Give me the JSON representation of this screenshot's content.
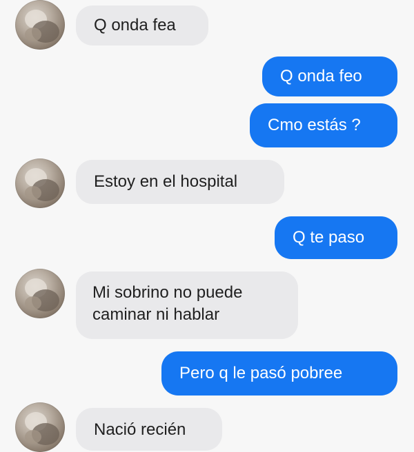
{
  "chat": {
    "messages": [
      {
        "side": "incoming",
        "text": "Q onda fea"
      },
      {
        "side": "outgoing",
        "text": "Q onda feo"
      },
      {
        "side": "outgoing",
        "text": "Cmo estás ?"
      },
      {
        "side": "incoming",
        "text": "Estoy en el hospital"
      },
      {
        "side": "outgoing",
        "text": "Q te paso"
      },
      {
        "side": "incoming",
        "lines": [
          "Mi sobrino no puede",
          "caminar ni hablar"
        ]
      },
      {
        "side": "outgoing",
        "text": "Pero q le pasó pobree"
      },
      {
        "side": "incoming",
        "text": "Nació recién"
      }
    ]
  },
  "colors": {
    "incoming_bubble": "#e9e9eb",
    "outgoing_bubble": "#1677f2",
    "background": "#f7f7f7"
  },
  "icons": {
    "avatar": "contact-avatar-icon"
  }
}
